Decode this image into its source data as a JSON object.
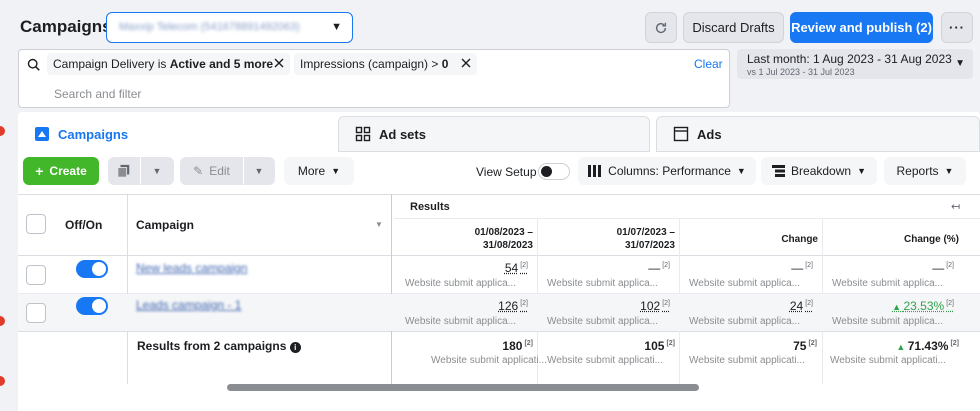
{
  "header": {
    "title": "Campaigns",
    "account_selector": "Maxxip Telecom (541678891492063)",
    "discard_label": "Discard Drafts",
    "review_label": "Review and publish (2)",
    "more_icon": "more-dots-icon"
  },
  "filters": {
    "chip1_prefix": "Campaign Delivery is ",
    "chip1_bold": "Active and 5 more",
    "chip2_prefix": "Impressions (campaign) > ",
    "chip2_bold": "0",
    "clear_label": "Clear",
    "search_placeholder": "Search and filter"
  },
  "date_range": {
    "main": "Last month: 1 Aug 2023 - 31 Aug 2023",
    "compare": "vs 1 Jul 2023 - 31 Jul 2023"
  },
  "tabs": [
    {
      "label": "Campaigns",
      "icon": "campaign-icon"
    },
    {
      "label": "Ad sets",
      "icon": "grid-icon"
    },
    {
      "label": "Ads",
      "icon": "ad-frame-icon"
    }
  ],
  "toolbar": {
    "create_label": "Create",
    "edit_label": "Edit",
    "more_label": "More",
    "view_setup_label": "View Setup",
    "columns_label": "Columns: Performance",
    "breakdown_label": "Breakdown",
    "reports_label": "Reports"
  },
  "table": {
    "headers": {
      "onoff": "Off/On",
      "campaign": "Campaign",
      "results": "Results",
      "period1_line1": "01/08/2023 –",
      "period1_line2": "31/08/2023",
      "period2_line1": "01/07/2023 –",
      "period2_line2": "31/07/2023",
      "change": "Change",
      "change_pct": "Change (%)"
    },
    "footnote": "[2]",
    "rows": [
      {
        "name": "New leads campaign",
        "period1": "54",
        "period2": "—",
        "change": "—",
        "change_pct": "—",
        "sub": "Website submit applica..."
      },
      {
        "name": "Leads campaign - 1",
        "period1": "126",
        "period2": "102",
        "change": "24",
        "change_pct": "23.53%",
        "sub": "Website submit applica..."
      }
    ],
    "total": {
      "label": "Results from 2 campaigns",
      "period1": "180",
      "period2": "105",
      "change": "75",
      "change_pct": "71.43%",
      "sub": "Website submit applicati..."
    }
  },
  "colors": {
    "accent": "#1877f2",
    "create": "#42b72a",
    "positive": "#31a24c"
  }
}
